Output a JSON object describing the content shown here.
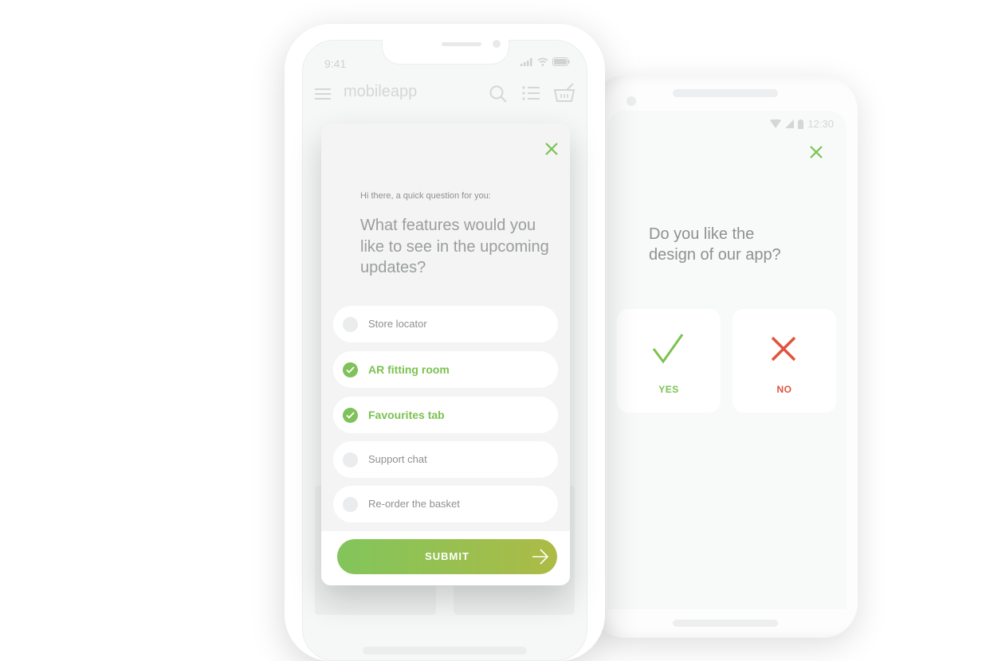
{
  "android": {
    "status_time": "12:30",
    "question": "Do you like the design of our app?",
    "question_line1": "Do you like the",
    "question_line2": "design of our app?",
    "yes_label": "YES",
    "no_label": "NO",
    "close_icon": "close-icon"
  },
  "iphone": {
    "status_time": "9:41",
    "app_title": "mobileapp",
    "icons": [
      "menu-icon",
      "search-icon",
      "list-icon",
      "basket-icon"
    ]
  },
  "survey": {
    "intro": "Hi there, a quick question for you:",
    "question": "What features would you like to see in the upcoming updates?",
    "options": [
      {
        "label": "Store locator",
        "checked": false
      },
      {
        "label": "AR fitting room",
        "checked": true
      },
      {
        "label": "Favourites tab",
        "checked": true
      },
      {
        "label": "Support chat",
        "checked": false
      },
      {
        "label": "Re-order the basket",
        "checked": false
      }
    ],
    "submit_label": "SUBMIT"
  },
  "colors": {
    "accent_green": "#7bc251",
    "no_red": "#e0533f",
    "gradient_end": "#adbb45"
  }
}
